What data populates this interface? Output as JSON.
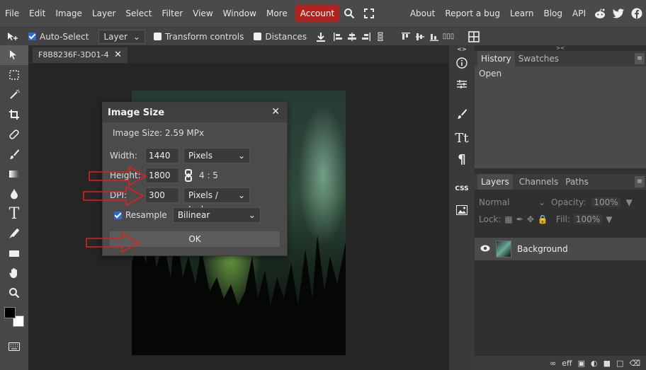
{
  "menubar": {
    "items": [
      "File",
      "Edit",
      "Image",
      "Layer",
      "Select",
      "Filter",
      "View",
      "Window",
      "More"
    ],
    "account": "Account",
    "right_items": [
      "About",
      "Report a bug",
      "Learn",
      "Blog",
      "API"
    ]
  },
  "optbar": {
    "auto_select": "Auto-Select",
    "layer_select": "Layer",
    "transform_controls": "Transform controls",
    "distances": "Distances"
  },
  "document": {
    "tab_name": "F8B8236F-3D01-4"
  },
  "dialog": {
    "title": "Image Size",
    "image_size_text": "Image Size: 2.59 MPx",
    "width_label": "Width:",
    "width_value": "1440",
    "width_unit": "Pixels",
    "height_label": "Height:",
    "height_value": "1800",
    "ratio": "4 : 5",
    "dpi_label": "DPI:",
    "dpi_value": "300",
    "dpi_unit": "Pixels / Inch",
    "resample_label": "Resample",
    "resample_method": "Bilinear",
    "ok_label": "OK"
  },
  "history": {
    "tabs": [
      "History",
      "Swatches"
    ],
    "entries": [
      "Open"
    ]
  },
  "layers": {
    "tabs": [
      "Layers",
      "Channels",
      "Paths"
    ],
    "blend_mode": "Normal",
    "opacity_label": "Opacity:",
    "opacity_value": "100%",
    "lock_label": "Lock:",
    "fill_label": "Fill:",
    "fill_value": "100%",
    "layer_name": "Background"
  },
  "colors": {
    "accent": "#b3221f",
    "arrow": "#e02020"
  }
}
